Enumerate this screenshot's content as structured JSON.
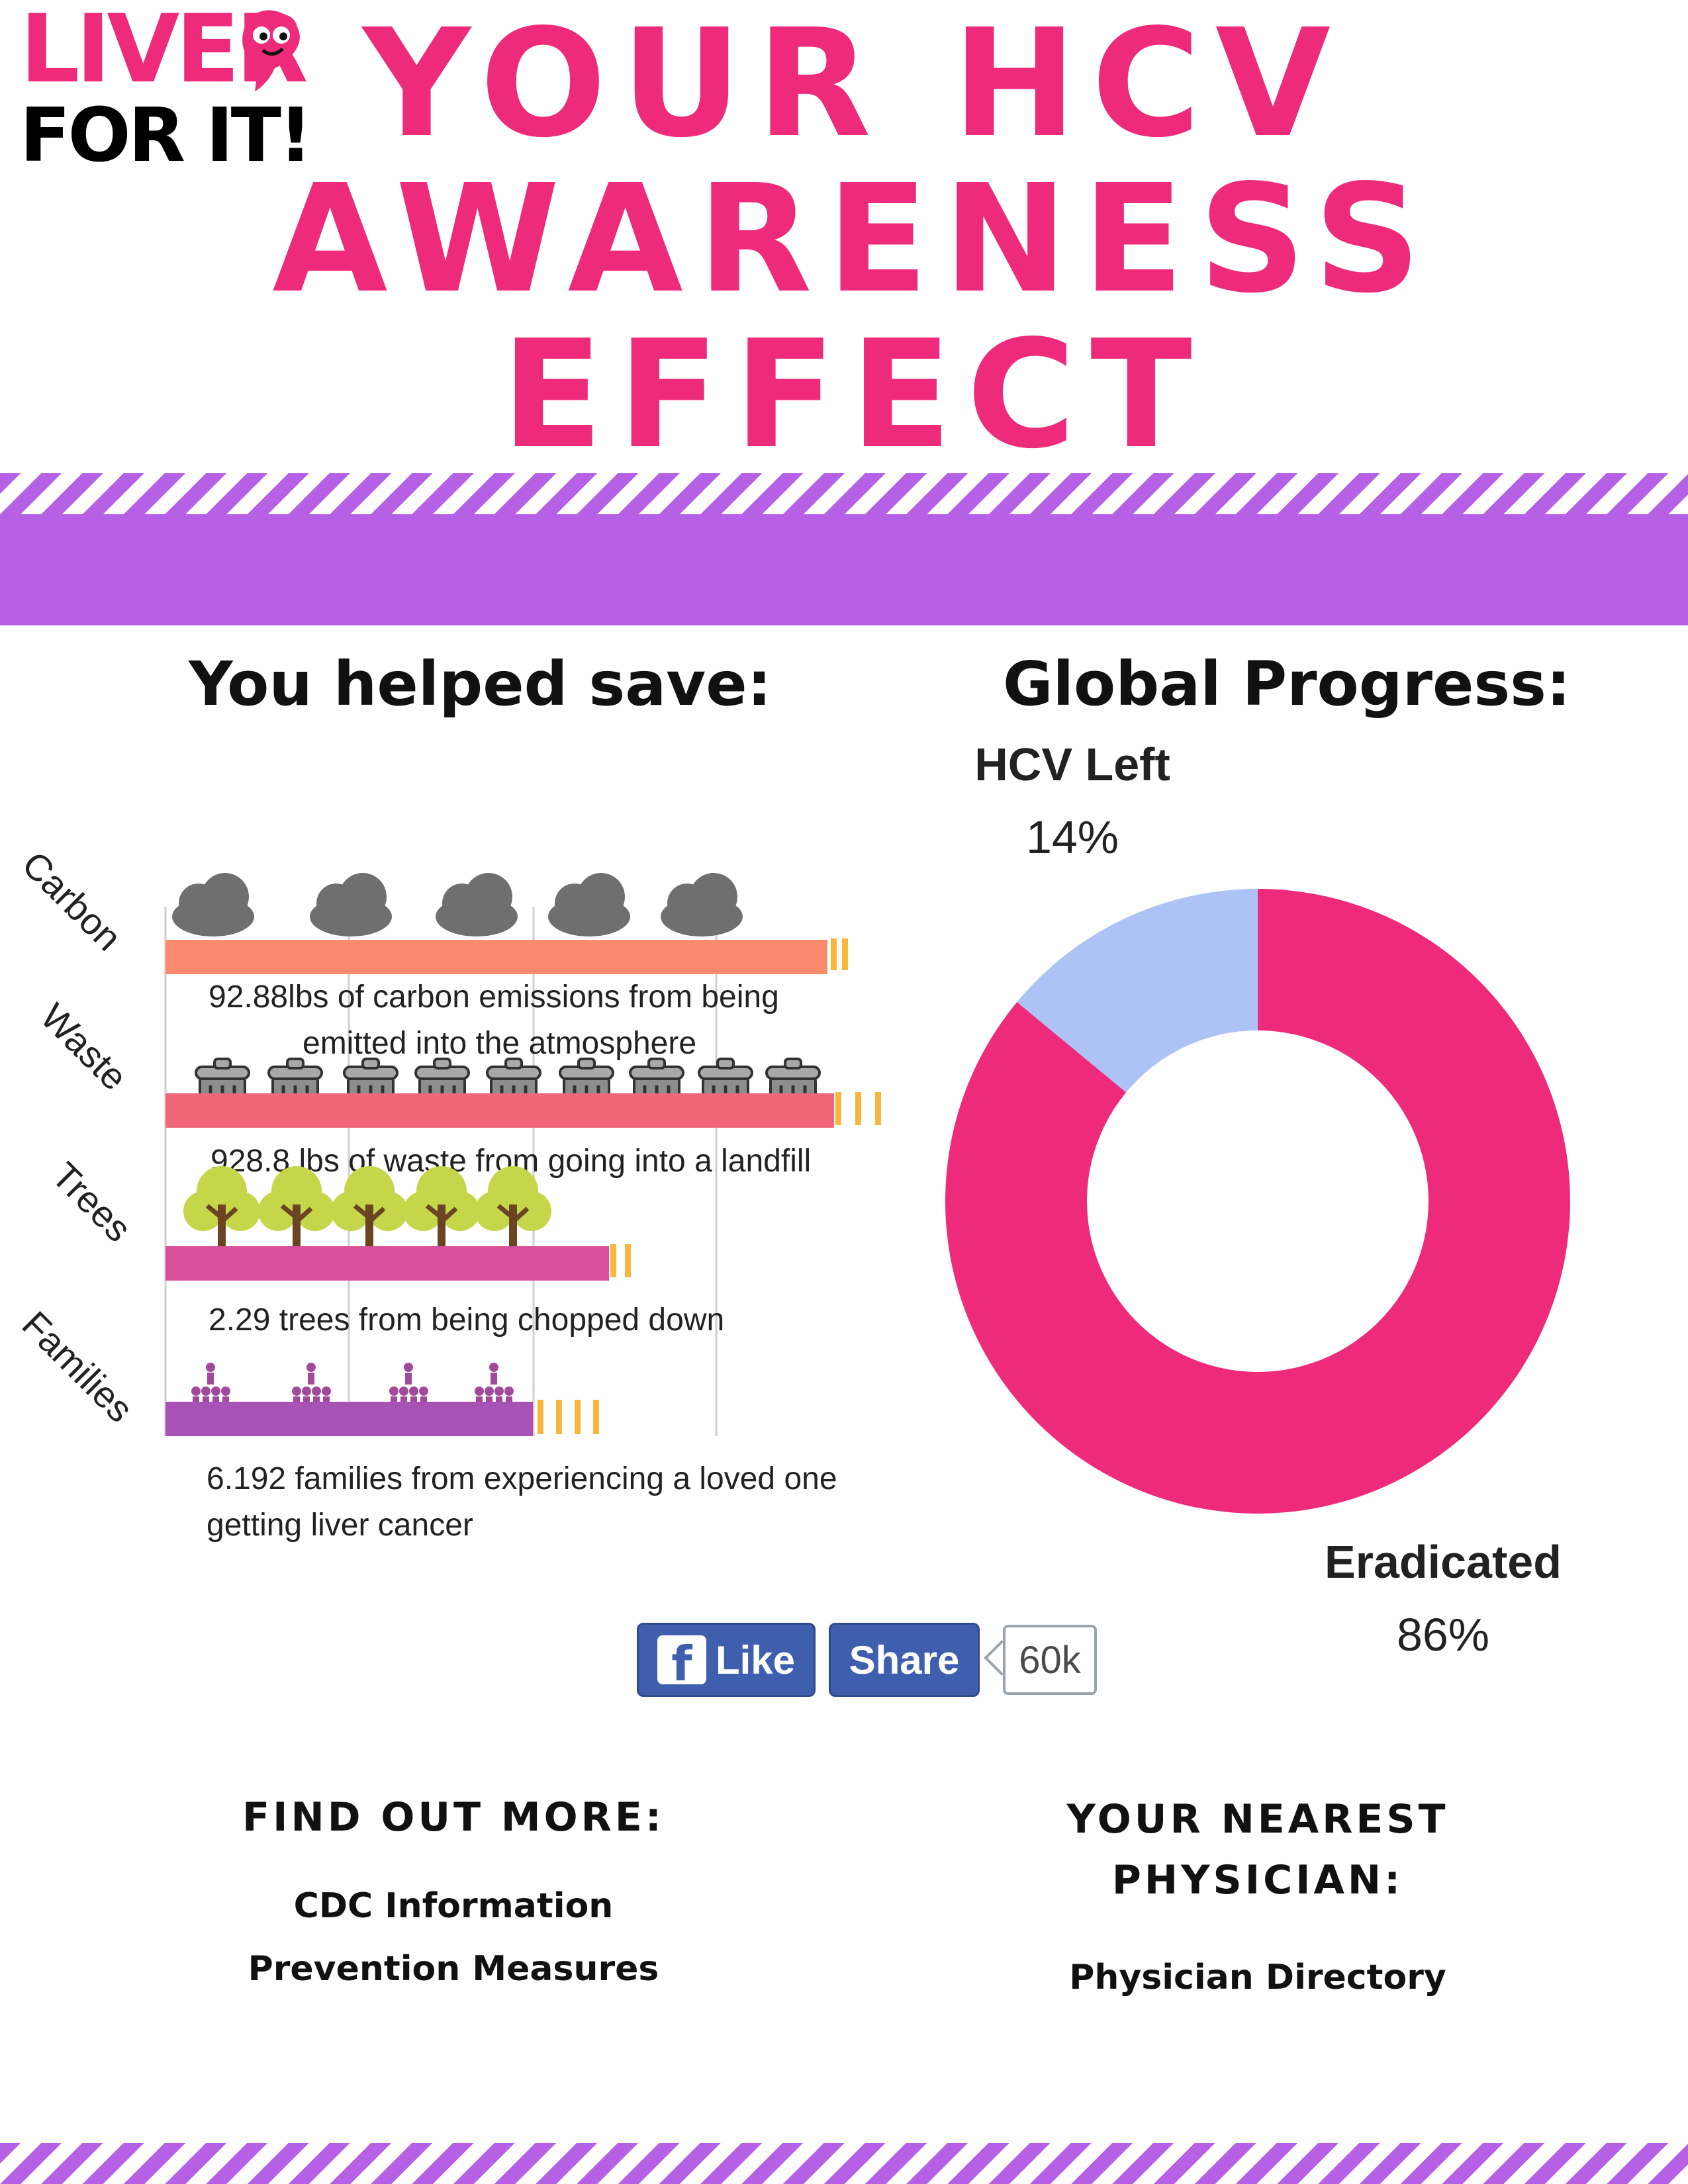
{
  "logo": {
    "line1": "LIVER",
    "line2": "FOR IT!"
  },
  "title": {
    "line1": "YOUR HCV",
    "line2": "AWARENESS",
    "line3": "EFFECT"
  },
  "sections": {
    "save_heading": "You helped save:",
    "progress_heading": "Global Progress:"
  },
  "impact_rows": [
    {
      "label": "Carbon",
      "caption_lines": [
        "92.88lbs of carbon emissions from being",
        "emitted into the atmosphere"
      ],
      "color": "#fc8a6e",
      "icon": "cloud-icon"
    },
    {
      "label": "Waste",
      "caption_lines": [
        "928.8 lbs of waste from going into a landfill"
      ],
      "color": "#f0677a",
      "icon": "trash-can-icon"
    },
    {
      "label": "Trees",
      "caption_lines": [
        "2.29 trees from being chopped down"
      ],
      "color": "#d8509a",
      "icon": "tree-icon"
    },
    {
      "label": "Families",
      "caption_lines": [
        "6.192 families from experiencing a loved one",
        "getting liver cancer"
      ],
      "color": "#a653b5",
      "icon": "family-icon"
    }
  ],
  "chart_data": {
    "type": "pie",
    "categories": [
      "HCV Left",
      "Eradicated"
    ],
    "values": [
      14,
      86
    ],
    "value_labels": [
      "14%",
      "86%"
    ],
    "colors": [
      "#aec3f5",
      "#ee2a7b"
    ]
  },
  "social": {
    "like_label": "Like",
    "share_label": "Share",
    "count": "60k",
    "facebook_icon": "facebook-icon"
  },
  "footer": {
    "find_heading": "FIND OUT MORE:",
    "cdc_link": "CDC Information",
    "prevention_link": "Prevention Measures",
    "physician_heading_line1": "YOUR NEAREST",
    "physician_heading_line2": "PHYSICIAN:",
    "directory_link": "Physician Directory"
  },
  "colors": {
    "brand_pink": "#ee2a7b",
    "band_purple": "#b660e6"
  }
}
